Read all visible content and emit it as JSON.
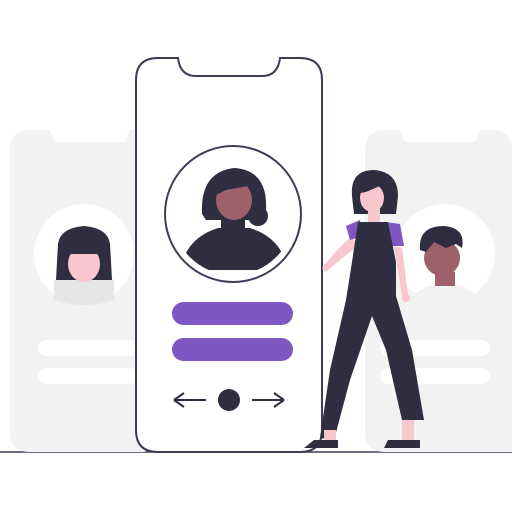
{
  "scene": {
    "type": "profile-swipe-illustration",
    "colors": {
      "accent": "#7e57c2",
      "dark": "#2f2e41",
      "skin": "#9e616a",
      "ghost": "#f2f2f2",
      "ghost_mid": "#e6e6e6",
      "outline": "#3f3d56",
      "ground": "#3f3d56"
    }
  },
  "phone": {
    "buttons": [
      {
        "name": "primary-action",
        "color": "#7e57c2"
      },
      {
        "name": "secondary-action",
        "color": "#7e57c2"
      }
    ],
    "nav": {
      "prev_icon": "arrow-left-icon",
      "center_icon": "dot-icon",
      "next_icon": "arrow-right-icon"
    }
  },
  "cards": {
    "left": {
      "avatar": "woman-avatar-icon"
    },
    "right": {
      "avatar": "man-avatar-icon"
    }
  }
}
